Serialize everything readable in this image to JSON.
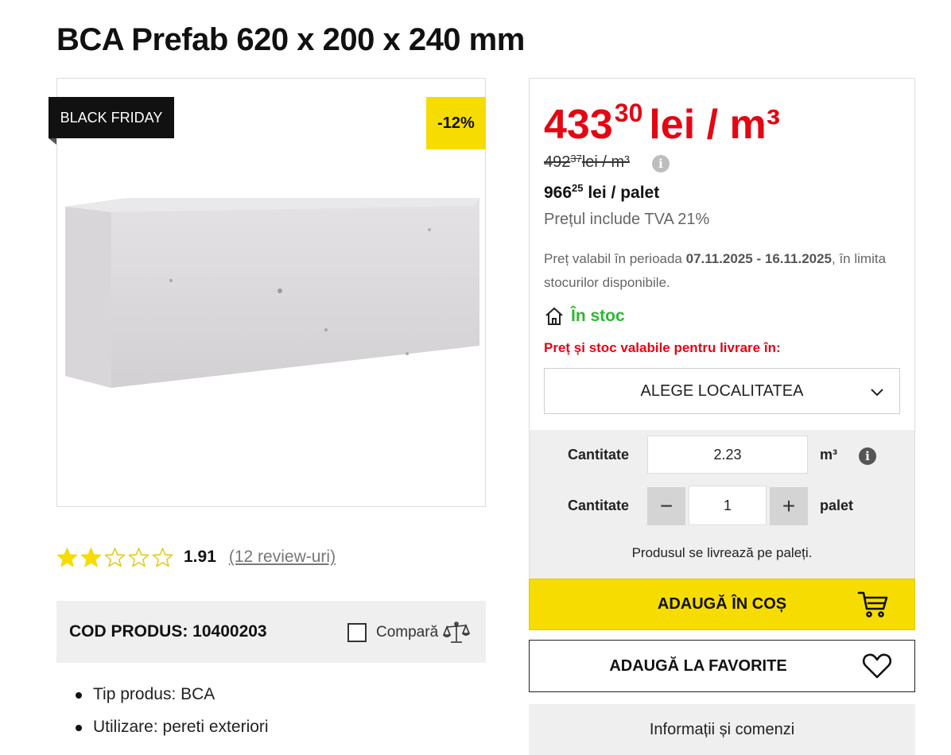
{
  "product": {
    "title": "BCA Prefab 620 x 200 x 240 mm",
    "badge_black_friday": "BLACK FRIDAY",
    "badge_discount": "-12%",
    "rating": {
      "stars_filled": 2,
      "stars_total": 5,
      "value": "1.91",
      "reviews_link": "(12 review-uri)"
    },
    "code_label": "COD PRODUS: 10400203",
    "compare_label": "Compară",
    "features": [
      "Tip produs: BCA",
      "Utilizare: pereti exteriori"
    ]
  },
  "price": {
    "main_int": "433",
    "main_dec": "30",
    "main_unit": "lei / m³",
    "old_int": "492",
    "old_dec": "37",
    "old_unit": " lei / m³",
    "pallet_int": "966",
    "pallet_dec": "25",
    "pallet_unit": " lei / palet",
    "vat_note": "Prețul include TVA 21%",
    "validity_prefix": "Preț valabil în perioada ",
    "validity_dates": "07.11.2025 - 16.11.2025",
    "validity_suffix": ", în limita stocurilor disponibile.",
    "stock_status": "În stoc",
    "delivery_note": "Preț și stoc valabile pentru livrare în:",
    "locality_select": "ALEGE LOCALITATEA"
  },
  "quantity": {
    "label": "Cantitate",
    "volume_value": "2.23",
    "volume_unit": "m³",
    "pallet_value": "1",
    "pallet_unit": "palet",
    "minus": "−",
    "plus": "+",
    "pallet_note": "Produsul se livrează pe paleți."
  },
  "actions": {
    "add_to_cart": "ADAUGĂ ÎN COȘ",
    "add_to_favorites": "ADAUGĂ LA FAVORITE",
    "info_orders": "Informații și comenzi"
  },
  "colors": {
    "accent_yellow": "#f6dc00",
    "price_red": "#e30613",
    "stock_green": "#2eb82e"
  }
}
